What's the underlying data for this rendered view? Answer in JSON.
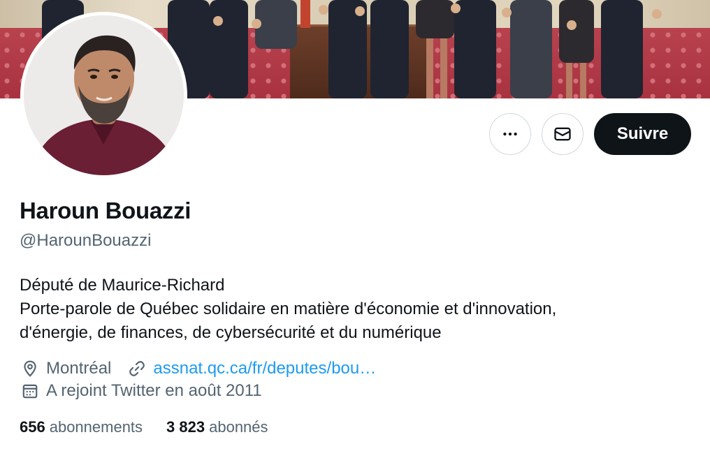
{
  "profile": {
    "display_name": "Haroun Bouazzi",
    "handle": "@HarounBouazzi",
    "bio_lines": [
      "Député de Maurice-Richard",
      "Porte-parole de Québec solidaire en matière d'économie et d'innovation,",
      "d'énergie, de finances, de cybersécurité et du numérique"
    ],
    "location": "Montréal",
    "website": "assnat.qc.ca/fr/deputes/bou…",
    "joined": "A rejoint Twitter en août 2011"
  },
  "actions": {
    "more_icon": "more-horizontal-icon",
    "message_icon": "envelope-icon",
    "follow_label": "Suivre"
  },
  "counts": {
    "following_value": "656",
    "following_label": "abonnements",
    "followers_value": "3 823",
    "followers_label": "abonnés"
  },
  "colors": {
    "text_primary": "#0f1419",
    "text_secondary": "#536471",
    "link": "#1d9bf0",
    "follow_bg": "#0f1419"
  }
}
